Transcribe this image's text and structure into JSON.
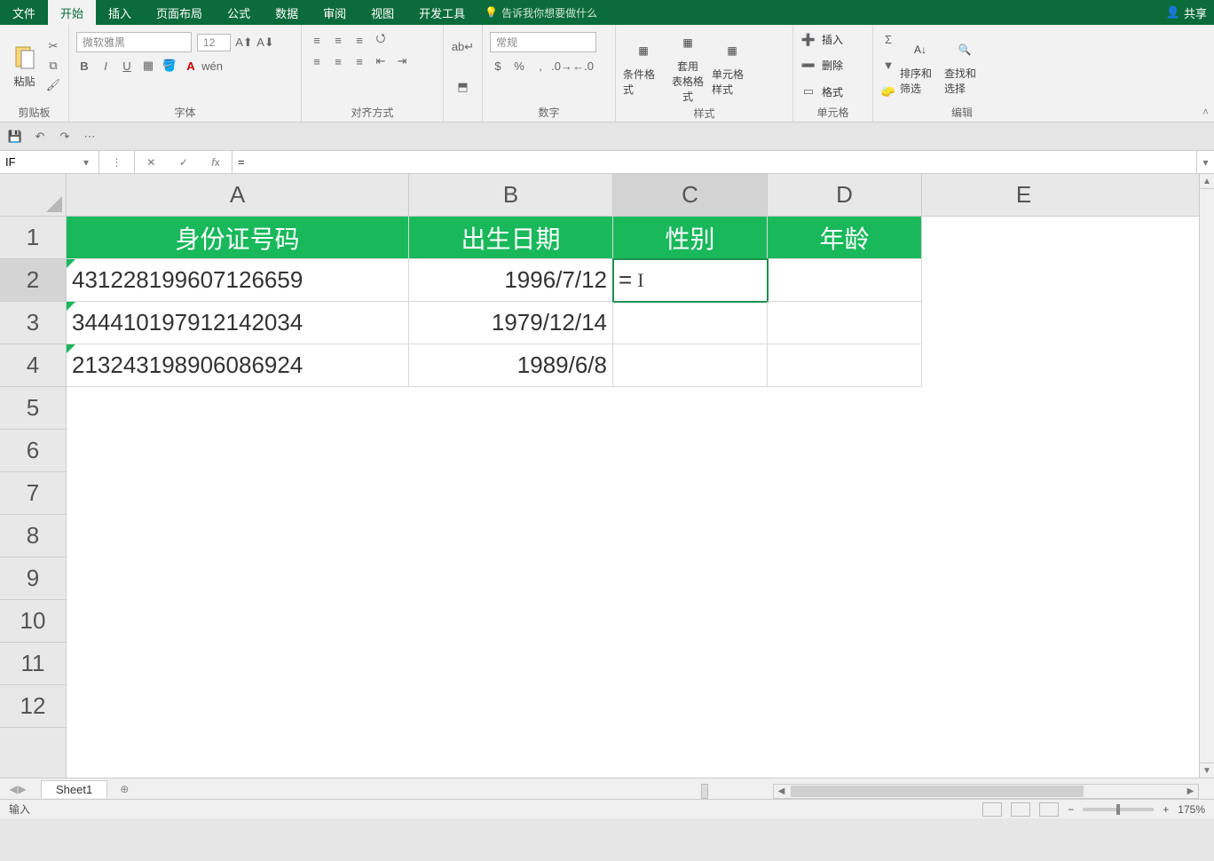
{
  "menu": {
    "file": "文件",
    "home": "开始",
    "insert": "插入",
    "layout": "页面布局",
    "formula": "公式",
    "data": "数据",
    "review": "审阅",
    "view": "视图",
    "dev": "开发工具",
    "tellme": "告诉我你想要做什么",
    "share": "共享"
  },
  "ribbon": {
    "clipboard": {
      "label": "剪贴板",
      "paste": "粘贴"
    },
    "font": {
      "label": "字体",
      "name": "微软雅黑",
      "size": "12"
    },
    "align": {
      "label": "对齐方式"
    },
    "number": {
      "label": "数字",
      "format": "常规"
    },
    "styles": {
      "label": "样式",
      "cond": "条件格式",
      "table": "套用\n表格格式",
      "cell": "单元格样式"
    },
    "cells": {
      "label": "单元格",
      "insert": "插入",
      "delete": "删除",
      "format": "格式"
    },
    "edit": {
      "label": "编辑",
      "sort": "排序和筛选",
      "find": "查找和选择"
    }
  },
  "fbar": {
    "name": "IF",
    "formula": "="
  },
  "columns": [
    "A",
    "B",
    "C",
    "D",
    "E"
  ],
  "headers": {
    "A": "身份证号码",
    "B": "出生日期",
    "C": "性别",
    "D": "年龄"
  },
  "data": [
    {
      "A": "431228199607126659",
      "B": "1996/7/12",
      "C": "=",
      "D": ""
    },
    {
      "A": "344410197912142034",
      "B": "1979/12/14",
      "C": "",
      "D": ""
    },
    {
      "A": "213243198906086924",
      "B": "1989/6/8",
      "C": "",
      "D": ""
    }
  ],
  "sheet": {
    "name": "Sheet1"
  },
  "status": {
    "mode": "输入",
    "zoom": "175%"
  }
}
